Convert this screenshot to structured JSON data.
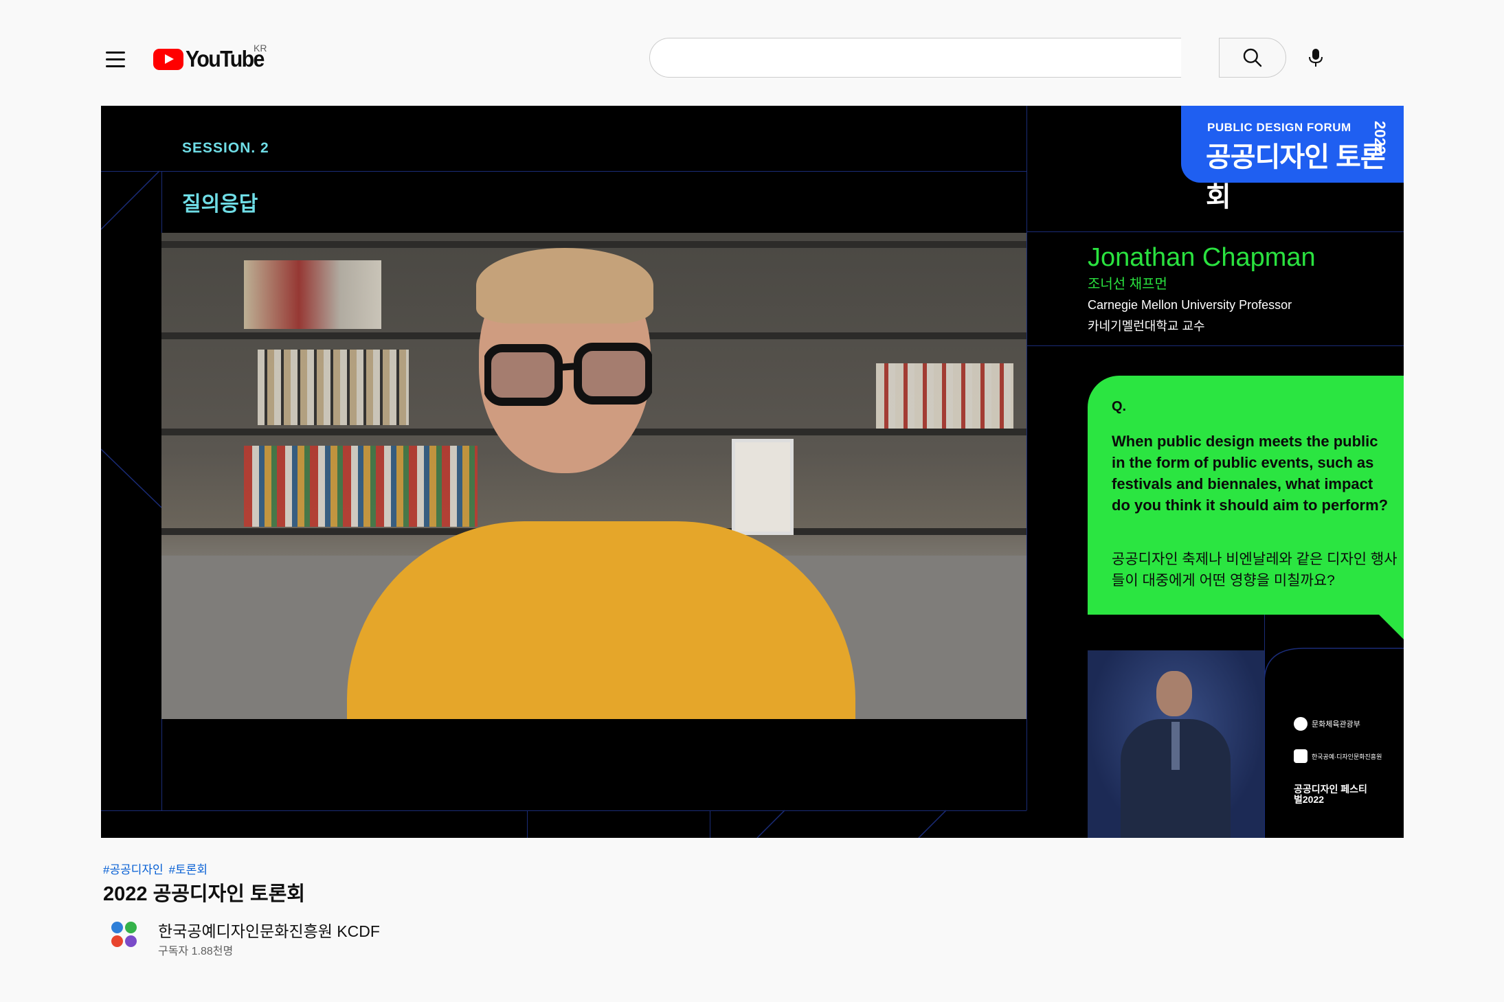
{
  "masthead": {
    "logo_text": "YouTube",
    "country_code": "KR",
    "search_placeholder": ""
  },
  "player": {
    "session_label": "SESSION. 2",
    "segment_title": "질의응답",
    "forum_badge": {
      "en": "PUBLIC DESIGN FORUM",
      "ko": "공공디자인 토론회",
      "year": "2022"
    },
    "speaker": {
      "name_en": "Jonathan Chapman",
      "name_ko": "조너선 채프먼",
      "affiliation_en": "Carnegie Mellon University Professor",
      "affiliation_ko": "카네기멜런대학교 교수"
    },
    "question": {
      "marker": "Q.",
      "text_en": "When public design meets the public in the form of public events, such as festivals and biennales, what impact do you think it should aim to perform?",
      "text_ko": "공공디자인 축제나 비엔날레와 같은 디자인 행사들이 대중에게 어떤 영향을 미칠까요?"
    },
    "sponsors": [
      {
        "label": "문화체육관광부"
      },
      {
        "label": "한국공예·디자인문화진흥원"
      },
      {
        "label": "공공디자인 페스티벌2022"
      }
    ]
  },
  "video": {
    "hashtags": [
      "#공공디자인",
      "#토론회"
    ],
    "title": "2022 공공디자인 토론회"
  },
  "channel": {
    "name": "한국공예디자인문화진흥원 KCDF",
    "subscribers": "구독자 1.88천명"
  },
  "colors": {
    "accent_green": "#2be541",
    "accent_cyan": "#6fdde6",
    "badge_blue": "#1f5ff1",
    "youtube_red": "#ff0000"
  }
}
